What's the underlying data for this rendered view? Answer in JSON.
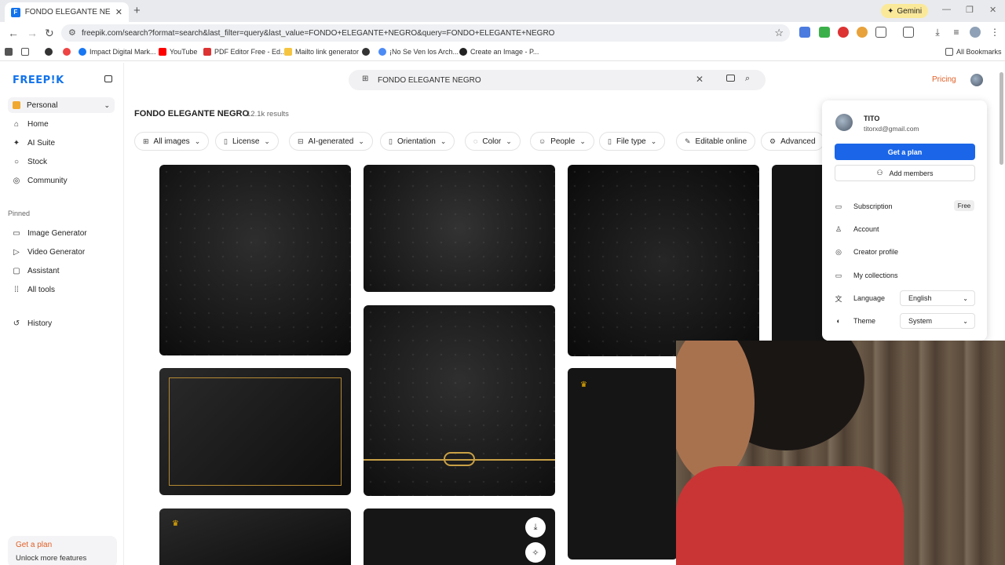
{
  "browser": {
    "tab_title": "FONDO ELEGANTE NEGRO vec",
    "new_tab": "+",
    "gemini_label": "Gemini",
    "url": "freepik.com/search?format=search&last_filter=query&last_value=FONDO+ELEGANTE+NEGRO&query=FONDO+ELEGANTE+NEGRO",
    "bookmarks": [
      "Impact Digital Mark...",
      "YouTube",
      "PDF Editor Free - Ed...",
      "Mailto link generator",
      "¡No Se Ven los Arch...",
      "Create an Image - P..."
    ],
    "all_bookmarks": "All Bookmarks"
  },
  "sidebar": {
    "logo": "FREEP!K",
    "workspace": "Personal",
    "nav": [
      "Home",
      "AI Suite",
      "Stock",
      "Community"
    ],
    "pinned_label": "Pinned",
    "pinned": [
      "Image Generator",
      "Video Generator",
      "Assistant",
      "All tools"
    ],
    "history": "History",
    "plan_cta": "Get a plan",
    "plan_sub": "Unlock more features"
  },
  "header": {
    "search_value": "FONDO ELEGANTE NEGRO",
    "pricing": "Pricing"
  },
  "results": {
    "title": "FONDO ELEGANTE NEGRO",
    "count": "12.1k results"
  },
  "filters": [
    "All images",
    "License",
    "AI-generated",
    "Orientation",
    "Color",
    "People",
    "File type",
    "Editable online",
    "Advanced"
  ],
  "account_menu": {
    "name": "TITO",
    "email": "titorxd@gmail.com",
    "get_plan": "Get a plan",
    "add_members": "Add members",
    "items": [
      "Subscription",
      "Account",
      "Creator profile",
      "My collections",
      "Language",
      "Theme"
    ],
    "subscription_badge": "Free",
    "language_value": "English",
    "theme_value": "System"
  },
  "colors": {
    "brand_blue": "#1273eb",
    "accent_orange": "#e05f26",
    "button_blue": "#1b66e8"
  }
}
